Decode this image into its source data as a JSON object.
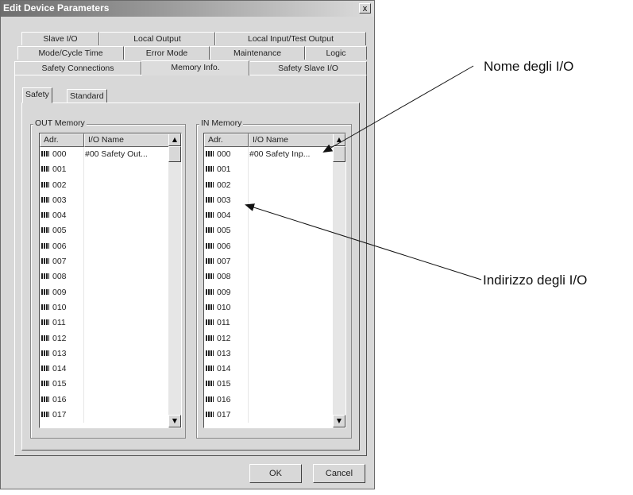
{
  "window": {
    "title": "Edit Device Parameters",
    "close_label": "x"
  },
  "tabs": {
    "row1": [
      "Slave I/O",
      "Local Output",
      "Local Input/Test Output"
    ],
    "row2": [
      "Mode/Cycle Time",
      "Error Mode",
      "Maintenance",
      "Logic"
    ],
    "row3": [
      "Safety Connections",
      "Memory Info.",
      "Safety Slave I/O"
    ],
    "active": "Memory Info."
  },
  "subtabs": {
    "items": [
      "Safety",
      "Standard"
    ],
    "active": "Safety"
  },
  "out_memory": {
    "label": "OUT Memory",
    "col_adr": "Adr.",
    "col_name": "I/O Name",
    "rows": [
      {
        "adr": "000",
        "name": "#00 Safety Out..."
      },
      {
        "adr": "001",
        "name": ""
      },
      {
        "adr": "002",
        "name": ""
      },
      {
        "adr": "003",
        "name": ""
      },
      {
        "adr": "004",
        "name": ""
      },
      {
        "adr": "005",
        "name": ""
      },
      {
        "adr": "006",
        "name": ""
      },
      {
        "adr": "007",
        "name": ""
      },
      {
        "adr": "008",
        "name": ""
      },
      {
        "adr": "009",
        "name": ""
      },
      {
        "adr": "010",
        "name": ""
      },
      {
        "adr": "011",
        "name": ""
      },
      {
        "adr": "012",
        "name": ""
      },
      {
        "adr": "013",
        "name": ""
      },
      {
        "adr": "014",
        "name": ""
      },
      {
        "adr": "015",
        "name": ""
      },
      {
        "adr": "016",
        "name": ""
      },
      {
        "adr": "017",
        "name": ""
      }
    ]
  },
  "in_memory": {
    "label": "IN Memory",
    "col_adr": "Adr.",
    "col_name": "I/O Name",
    "rows": [
      {
        "adr": "000",
        "name": "#00 Safety Inp..."
      },
      {
        "adr": "001",
        "name": ""
      },
      {
        "adr": "002",
        "name": ""
      },
      {
        "adr": "003",
        "name": ""
      },
      {
        "adr": "004",
        "name": ""
      },
      {
        "adr": "005",
        "name": ""
      },
      {
        "adr": "006",
        "name": ""
      },
      {
        "adr": "007",
        "name": ""
      },
      {
        "adr": "008",
        "name": ""
      },
      {
        "adr": "009",
        "name": ""
      },
      {
        "adr": "010",
        "name": ""
      },
      {
        "adr": "011",
        "name": ""
      },
      {
        "adr": "012",
        "name": ""
      },
      {
        "adr": "013",
        "name": ""
      },
      {
        "adr": "014",
        "name": ""
      },
      {
        "adr": "015",
        "name": ""
      },
      {
        "adr": "016",
        "name": ""
      },
      {
        "adr": "017",
        "name": ""
      }
    ]
  },
  "buttons": {
    "ok": "OK",
    "cancel": "Cancel"
  },
  "callouts": {
    "io_name": "Nome degli I/O",
    "io_address": "Indirizzo degli I/O"
  }
}
